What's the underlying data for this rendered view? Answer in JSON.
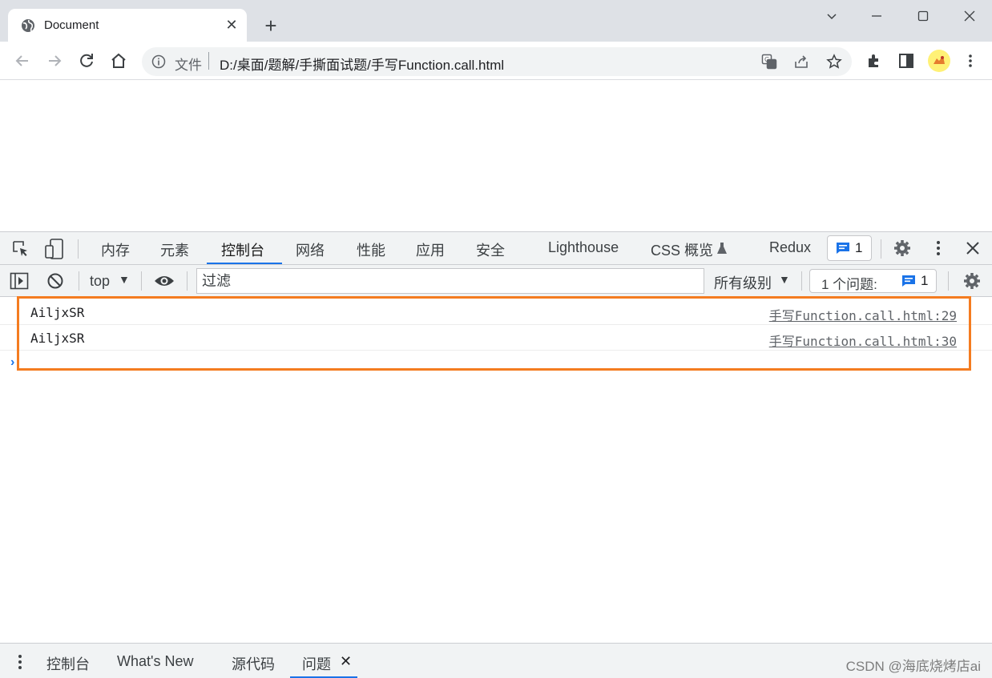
{
  "browser": {
    "tab": {
      "title": "Document",
      "favicon": "globe-icon"
    },
    "new_tab_label": "+",
    "address_bar": {
      "scheme_label": "文件",
      "url": "D:/桌面/题解/手撕面试题/手写Function.call.html"
    },
    "accent_color": "#1a73e8"
  },
  "devtools": {
    "tabs": [
      {
        "label": "内存"
      },
      {
        "label": "元素"
      },
      {
        "label": "控制台",
        "active": true
      },
      {
        "label": "网络"
      },
      {
        "label": "性能"
      },
      {
        "label": "应用"
      },
      {
        "label": "安全"
      },
      {
        "label": "Lighthouse"
      },
      {
        "label": "CSS 概览"
      },
      {
        "label": "Redux"
      }
    ],
    "issues_badge_count": "1",
    "console_toolbar": {
      "context": "top",
      "filter_placeholder": "过滤",
      "levels": "所有级别",
      "issues_label": "1 个问题:",
      "issues_count": "1"
    },
    "console": {
      "messages": [
        {
          "text": "AiljxSR",
          "source": "手写Function.call.html:29"
        },
        {
          "text": "AiljxSR",
          "source": "手写Function.call.html:30"
        }
      ],
      "prompt": "›",
      "highlight_color": "#f47c20"
    },
    "drawer": {
      "tabs": [
        {
          "label": "控制台"
        },
        {
          "label": "What's New"
        },
        {
          "label": "源代码"
        },
        {
          "label": "问题",
          "active": true
        }
      ],
      "close_label": "✕"
    }
  },
  "watermark": "CSDN @海底烧烤店ai"
}
